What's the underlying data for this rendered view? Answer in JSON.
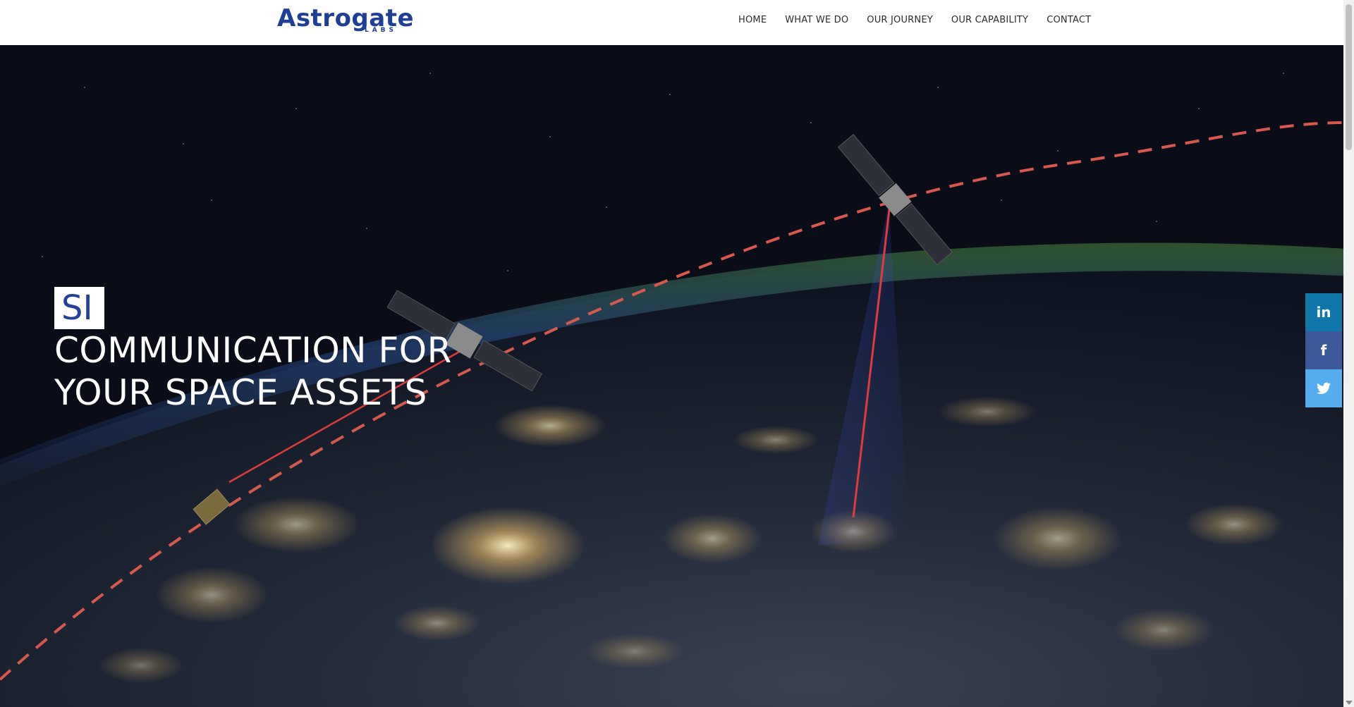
{
  "brand": {
    "name": "Astrogate",
    "sub": "LABS"
  },
  "nav": [
    {
      "label": "HOME"
    },
    {
      "label": "WHAT WE DO"
    },
    {
      "label": "OUR JOURNEY"
    },
    {
      "label": "OUR CAPABILITY"
    },
    {
      "label": "CONTACT"
    }
  ],
  "hero": {
    "badge": "SI",
    "line1": "COMMUNICATION FOR",
    "line2": "YOUR SPACE ASSETS"
  },
  "social": [
    {
      "name": "linkedin",
      "glyph": "in",
      "color": "#0e76a8"
    },
    {
      "name": "facebook",
      "glyph": "f",
      "color": "#3b5998"
    },
    {
      "name": "twitter",
      "glyph": "t",
      "color": "#55acee"
    }
  ],
  "colors": {
    "brand": "#1f3f97",
    "laser": "#e03a3a",
    "orbit": "#d9584d"
  }
}
